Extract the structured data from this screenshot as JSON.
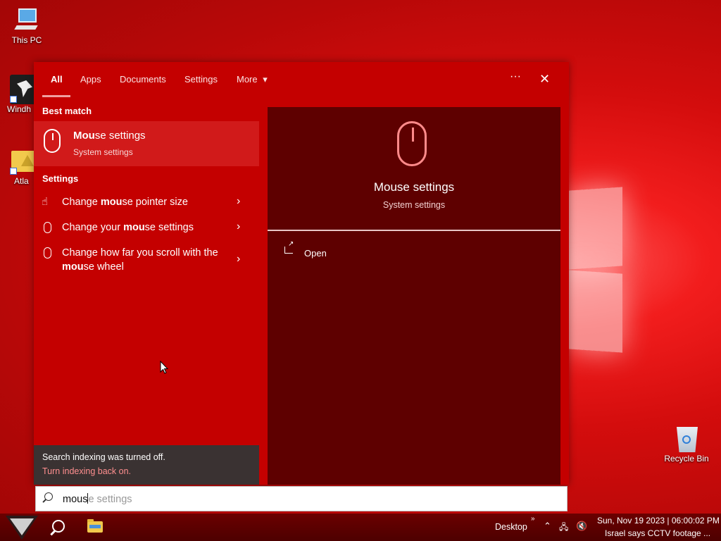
{
  "desktop": {
    "icons": [
      {
        "label": "This PC"
      },
      {
        "label": "Windh"
      },
      {
        "label": "Atla"
      },
      {
        "label": "Recycle Bin"
      }
    ]
  },
  "search_panel": {
    "tabs": [
      {
        "label": "All"
      },
      {
        "label": "Apps"
      },
      {
        "label": "Documents"
      },
      {
        "label": "Settings"
      },
      {
        "label": "More"
      }
    ],
    "more_chevron": "▾",
    "ellipsis": "···",
    "close": "✕",
    "best_match_heading": "Best match",
    "best_match": {
      "title_bold": "Mou",
      "title_rest": "se settings",
      "subtitle": "System settings"
    },
    "settings_heading": "Settings",
    "settings_items": [
      {
        "pre": "Change ",
        "bold": "mou",
        "post": "se pointer size"
      },
      {
        "pre": "Change your ",
        "bold": "mou",
        "post": "se settings"
      },
      {
        "pre": "Change how far you scroll with the ",
        "bold": "mou",
        "post": "se wheel"
      }
    ],
    "chevron": "›",
    "indexing": {
      "message": "Search indexing was turned off.",
      "link": "Turn indexing back on."
    },
    "preview": {
      "title": "Mouse settings",
      "subtitle": "System settings",
      "action": "Open"
    }
  },
  "search_box": {
    "typed": "mous",
    "suggestion": "e settings"
  },
  "taskbar": {
    "desktop_label": "Desktop",
    "overflow": "»",
    "clock": "Sun, Nov 19 2023 | 06:00:02 PM",
    "news": "Israel says CCTV footage ..."
  }
}
